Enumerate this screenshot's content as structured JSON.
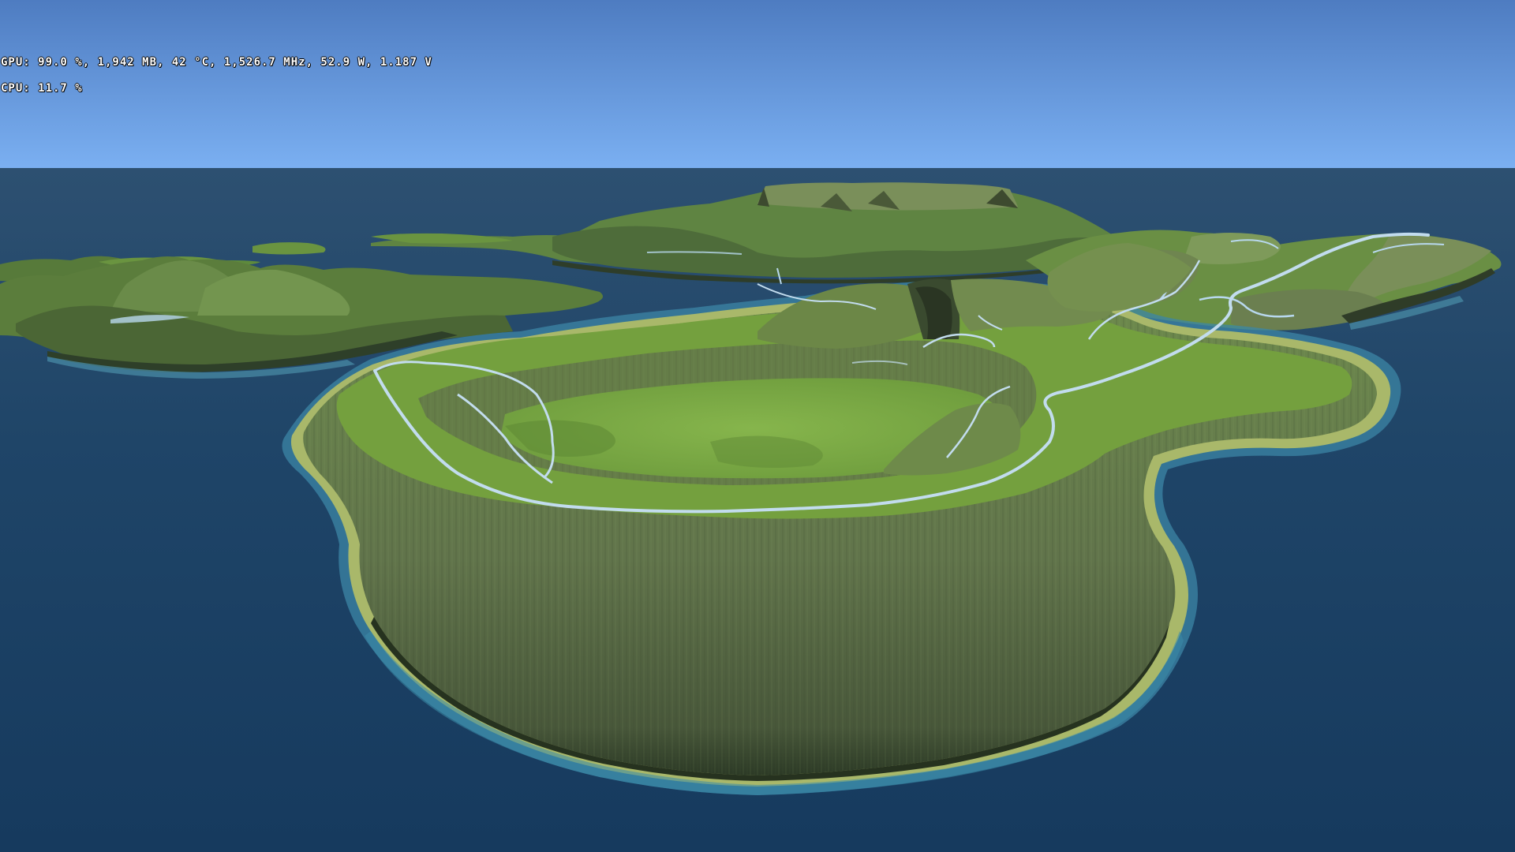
{
  "overlay": {
    "gpu_line": "GPU: 99.0 %, 1,942 MB, 42 °C, 1,526.7 MHz, 52.9 W, 1.187 V",
    "cpu_line": "CPU: 11.7 %"
  },
  "scene": {
    "description_colors": {
      "sky_top": "#4f7dc2",
      "sky_horizon": "#79aef0",
      "sea_far": "#2a4d6e",
      "sea_near": "#183a5e",
      "grass": "#6f9e3c",
      "grass_light": "#8fbe4e",
      "cliff": "#5f7448",
      "cliff_dark": "#2e3a26",
      "shore": "#a8b86a",
      "shallow": "#3f8fb0",
      "road": "#b8d8ee"
    }
  }
}
